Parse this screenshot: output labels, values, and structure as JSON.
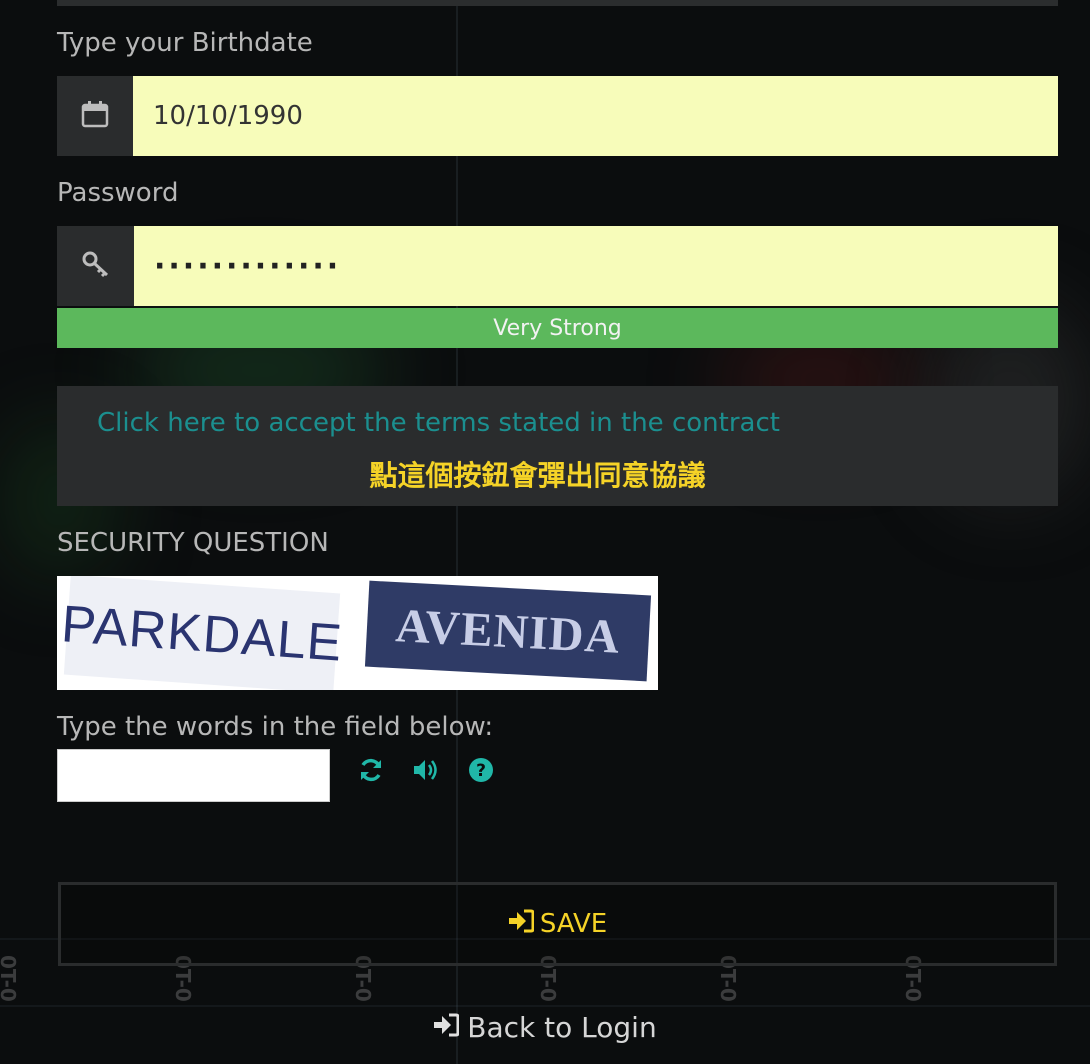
{
  "birthdate": {
    "label": "Type your Birthdate",
    "value": "10/10/1990",
    "icon": "calendar-icon"
  },
  "password": {
    "label": "Password",
    "masked_value": "·············",
    "icon": "key-icon",
    "strength": "Very Strong"
  },
  "terms": {
    "link_text": "Click here to accept the terms stated in the contract",
    "note_zh": "點這個按鈕會彈出同意協議"
  },
  "security": {
    "heading": "SECURITY QUESTION",
    "captcha_words": [
      "PARKDALE",
      "AVENIDA"
    ],
    "prompt": "Type the words in the field below:",
    "input_value": "",
    "icons": [
      "refresh-icon",
      "audio-icon",
      "help-icon"
    ]
  },
  "actions": {
    "save_label": "SAVE",
    "back_label": "Back to Login"
  },
  "colors": {
    "input_bg": "#f7fcba",
    "addon_bg": "#2a2c2d",
    "strength_bar": "#5cb85c",
    "link": "#1b8f8f",
    "accent_yellow": "#f5d327",
    "icon_teal": "#20b7a8"
  }
}
